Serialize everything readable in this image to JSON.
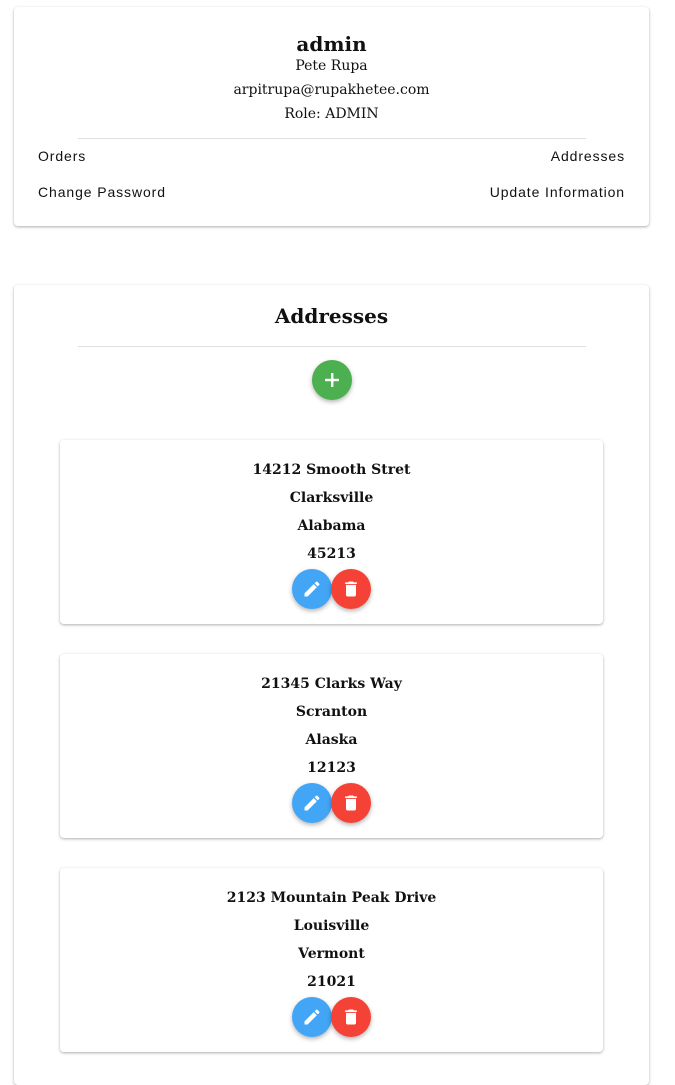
{
  "profile": {
    "username": "admin",
    "full_name": "Pete Rupa",
    "email": "arpitrupa@rupakhetee.com",
    "role_label": "Role:",
    "role_value": "ADMIN",
    "links": {
      "orders": "Orders",
      "addresses": "Addresses",
      "change_password": "Change Password",
      "update_information": "Update Information"
    }
  },
  "addresses_section": {
    "title": "Addresses",
    "add_icon": "plus-icon",
    "edit_icon": "pencil-icon",
    "delete_icon": "trash-icon",
    "colors": {
      "add_button": "#4caf50",
      "edit_button": "#42a5f5",
      "delete_button": "#f44336"
    },
    "items": [
      {
        "street": "14212 Smooth Stret",
        "city": "Clarksville",
        "state": "Alabama",
        "zip": "45213"
      },
      {
        "street": "21345 Clarks Way",
        "city": "Scranton",
        "state": "Alaska",
        "zip": "12123"
      },
      {
        "street": "2123 Mountain Peak Drive",
        "city": "Louisville",
        "state": "Vermont",
        "zip": "21021"
      }
    ]
  }
}
